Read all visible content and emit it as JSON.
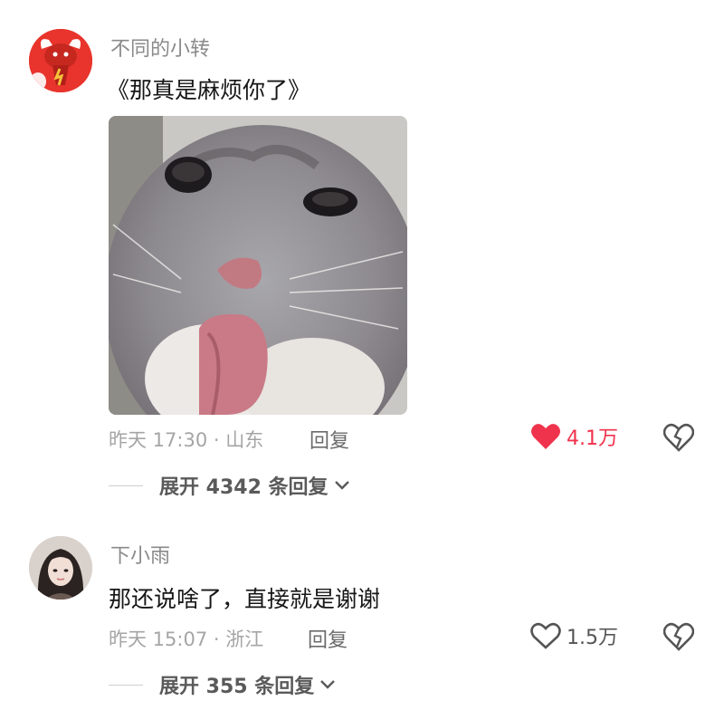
{
  "comments": [
    {
      "username": "不同的小转",
      "text": "《那真是麻烦你了》",
      "time_location": "昨天 17:30 · 山东",
      "reply_label": "回复",
      "like_count": "4.1万",
      "liked": true,
      "expand_label": "展开 4342 条回复"
    },
    {
      "username": "下小雨",
      "text": "那还说啥了，直接就是谢谢",
      "time_location": "昨天 15:07 · 浙江",
      "reply_label": "回复",
      "like_count": "1.5万",
      "liked": false,
      "expand_label": "展开 355 条回复"
    }
  ],
  "colors": {
    "like_active": "#f0334c",
    "meta_gray": "#a5a5a5",
    "username_gray": "#8a8a8a"
  }
}
